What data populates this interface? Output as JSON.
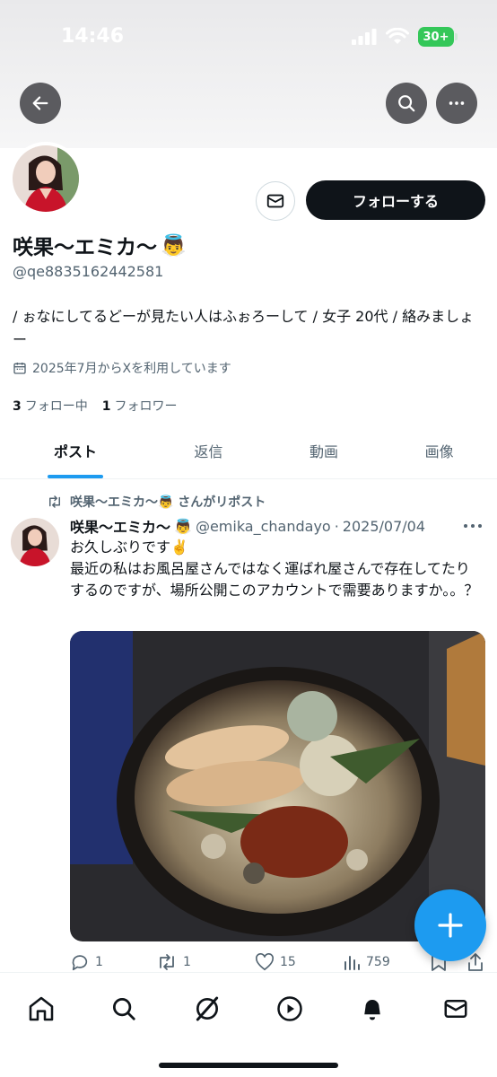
{
  "status_bar": {
    "time": "14:46",
    "battery": "30+"
  },
  "header": {
    "back_icon": "arrow-left-icon",
    "search_icon": "search-icon",
    "more_icon": "more-icon"
  },
  "profile": {
    "display_name": "咲果〜エミカ〜",
    "name_emoji": "👼",
    "handle": "@qe8835162442581",
    "follow_button": "フォローする",
    "bio": "/ ぉなにしてるどーが見たい人はふぉろーして / 女子 20代 / 絡みましょー",
    "joined": "2025年7月からXを利用しています",
    "following_count": "3",
    "following_label": "フォロー中",
    "followers_count": "1",
    "followers_label": "フォロワー"
  },
  "tabs": [
    {
      "label": "ポスト",
      "active": true
    },
    {
      "label": "返信",
      "active": false
    },
    {
      "label": "動画",
      "active": false
    },
    {
      "label": "画像",
      "active": false
    }
  ],
  "post": {
    "repost_label": "咲果〜エミカ〜👼 さんがリポスト",
    "author_name": "咲果〜エミカ〜",
    "author_emoji": "👼",
    "author_handle": "@emika_chandayo",
    "date": "2025/07/04",
    "meta_separator": "·",
    "text_line1": "お久しぶりです✌️",
    "text_body": "最近の私はお風呂屋さんではなく運ばれ屋さんで存在してたりするのですが、場所公開このアカウントで需要ありますか。。？",
    "replies": "1",
    "reposts": "1",
    "likes": "15",
    "views": "759"
  },
  "colors": {
    "accent": "#1d9bf0",
    "text_primary": "#0f1419",
    "text_secondary": "#536471",
    "follow_button_bg": "#0f1419"
  }
}
